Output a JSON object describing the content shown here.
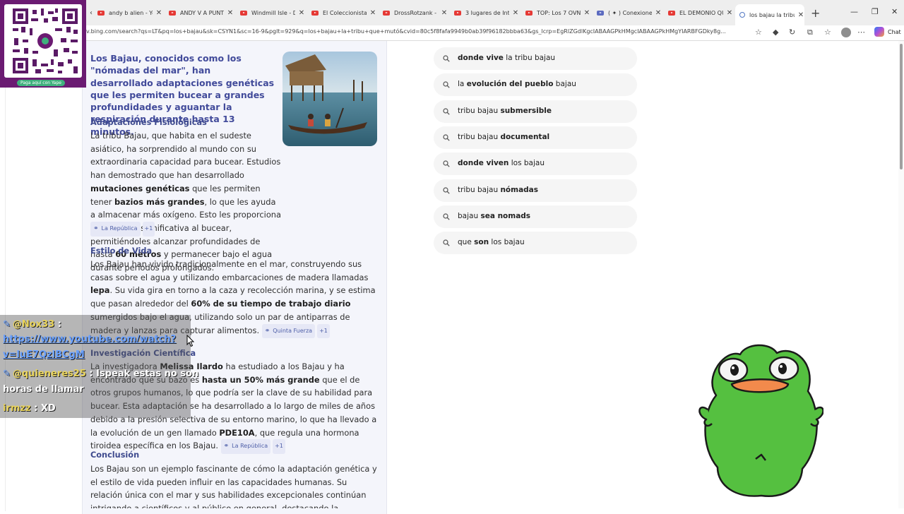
{
  "browser": {
    "tabs": [
      {
        "label": "andy b alien - You",
        "icon": "youtube-icon"
      },
      {
        "label": "ANDY V A PUNTO",
        "icon": "youtube-icon"
      },
      {
        "label": "Windmill Isle - Da",
        "icon": "youtube-icon"
      },
      {
        "label": "El Coleccionista D",
        "icon": "youtube-icon"
      },
      {
        "label": "DrossRotzank - Yo",
        "icon": "youtube-icon"
      },
      {
        "label": "3 lugares de Inter",
        "icon": "youtube-icon"
      },
      {
        "label": "TOP: Los 7 OVNIS",
        "icon": "youtube-icon"
      },
      {
        "label": "( ✦ ) Conexiones",
        "icon": "page-icon"
      },
      {
        "label": "EL DEMONIO QUE",
        "icon": "youtube-icon"
      },
      {
        "label": "los bajau la tribu",
        "icon": "search-icon",
        "active": true
      }
    ],
    "url": "v.bing.com/search?qs=LT&pq=los+bajau&sk=CSYN1&sc=16-9&pglt=929&q=los+bajau+la+tribu+que+mutó&cvid=80c5f8fafa9949b0ab39f96182bbba63&gs_lcrp=EgRlZGdlKgcIABAAGPkHMgcIABAAGPkHMgYIARBFGDky8g...",
    "chat_label": "Chat"
  },
  "overlay": {
    "qr_caption": "Paga aquí con Yape"
  },
  "answer": {
    "headline": "Los Bajau, conocidos como los \"nómadas del mar\", han desarrollado adaptaciones genéticas que les permiten bucear a grandes profundidades y aguantar la respiración durante hasta 13 minutos.",
    "sections": [
      {
        "title": "Adaptaciones Fisiológicas",
        "text_1": "La tribu Bajau, que habita en el sudeste asiático, ha sorprendido al mundo con su extraordinaria capacidad para bucear. Estudios han demostrado que han desarrollado ",
        "bold_1": "mutaciones genéticas",
        "text_2": " que les permiten tener ",
        "bold_2": "bazios más grandes",
        "text_3": ", lo que les ayuda a almacenar más oxígeno. Esto les proporciona una ventaja significativa al bucear, permitiéndoles alcanzar profundidades de hasta ",
        "bold_3": "60 metros",
        "text_4": " y permanecer bajo el agua durante períodos prolongados.",
        "source": "La República",
        "more": "+1"
      },
      {
        "title": "Estilo de Vida",
        "text_1": "Los Bajau han vivido tradicionalmente en el mar, construyendo sus casas sobre el agua y utilizando embarcaciones de madera llamadas ",
        "bold_1": "lepa",
        "text_2": ". Su vida gira en torno a la caza y recolección marina, y se estima que pasan alrededor del ",
        "bold_2": "60% de su tiempo de trabajo diario",
        "text_3": " sumergidos bajo el agua, utilizando solo un par de antiparras de madera y lanzas para capturar alimentos.",
        "source": "Quinta Fuerza",
        "more": "+1"
      },
      {
        "title": "Investigación Científica",
        "text_1": "La investigadora ",
        "bold_1": "Melissa Ilardo",
        "text_2": " ha estudiado a los Bajau y ha encontrado que su bazo es ",
        "bold_2": "hasta un 50% más grande",
        "text_3": " que el de otros grupos humanos, lo que podría ser la clave de su habilidad para bucear. Esta adaptación se ha desarrollado a lo largo de miles de años debido a la presión selectiva de su entorno marino, lo que ha llevado a la evolución de un gen llamado ",
        "bold_3": "PDE10A",
        "text_4": ", que regula una hormona tiroidea específica en los Bajau.",
        "source": "La República",
        "more": "+1"
      },
      {
        "title": "Conclusión",
        "text_1": "Los Bajau son un ejemplo fascinante de cómo la adaptación genética y el estilo de vida pueden influir en las capacidades humanas. Su relación única con el mar y sus habilidades excepcionales continúan intrigando a científicos y al público en general, destacando la diversidad y la resiliencia..."
      }
    ]
  },
  "related": [
    [
      {
        "t": "donde vive",
        "b": true
      },
      {
        "t": " la tribu bajau",
        "b": false
      }
    ],
    [
      {
        "t": "la ",
        "b": false
      },
      {
        "t": "evolución del pueblo",
        "b": true
      },
      {
        "t": " bajau",
        "b": false
      }
    ],
    [
      {
        "t": "tribu bajau ",
        "b": false
      },
      {
        "t": "submersible",
        "b": true
      }
    ],
    [
      {
        "t": "tribu bajau ",
        "b": false
      },
      {
        "t": "documental",
        "b": true
      }
    ],
    [
      {
        "t": "donde viven",
        "b": true
      },
      {
        "t": " los bajau",
        "b": false
      }
    ],
    [
      {
        "t": "tribu bajau ",
        "b": false
      },
      {
        "t": "nómadas",
        "b": true
      }
    ],
    [
      {
        "t": "bajau ",
        "b": false
      },
      {
        "t": "sea nomads",
        "b": true
      }
    ],
    [
      {
        "t": "que ",
        "b": false
      },
      {
        "t": "son",
        "b": true
      },
      {
        "t": " los bajau",
        "b": false
      }
    ]
  ],
  "chat": [
    {
      "user": "@Nox33",
      "sep": " :",
      "link_1": "https://www.youtube.com/watch?",
      "link_2": "v=luE7QzlBCgM"
    },
    {
      "user": "@quieneres25",
      "sep": " : ",
      "msg": "Ispeak estas no son",
      "msg_2": "horas de llamar"
    },
    {
      "user": "irmzz",
      "sep": " : ",
      "msg": "XD"
    }
  ],
  "colors": {
    "accent_heading": "#414a9a",
    "card_bg": "#f4f5fb",
    "frog_green": "#55c040"
  }
}
